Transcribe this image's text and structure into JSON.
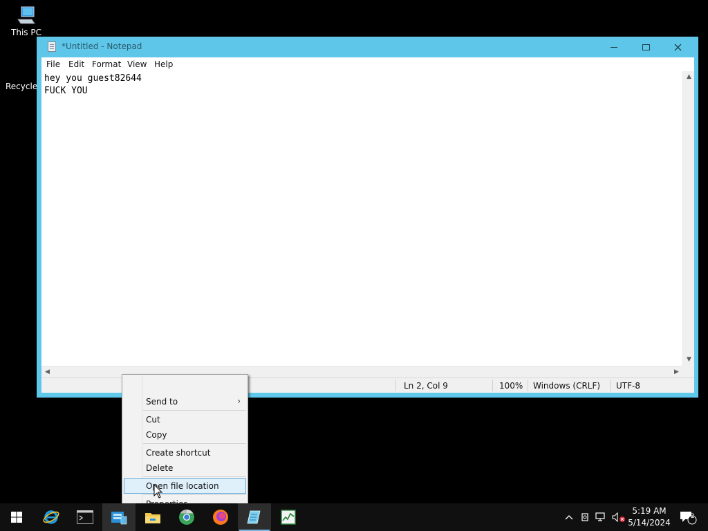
{
  "desktop": {
    "icons": [
      {
        "label": "This PC"
      },
      {
        "label": "Recycle"
      }
    ]
  },
  "notepad": {
    "title": "*Untitled - Notepad",
    "menu": [
      "File",
      "Edit",
      "Format",
      "View",
      "Help"
    ],
    "content_lines": [
      "hey you guest82644",
      "FUCK YOU"
    ],
    "status": {
      "position": "Ln 2, Col 9",
      "zoom": "100%",
      "line_endings": "Windows (CRLF)",
      "encoding": "UTF-8"
    }
  },
  "context_menu": {
    "items": [
      {
        "label": "Send to"
      },
      {
        "label": "Cut"
      },
      {
        "label": "Copy"
      },
      {
        "label": "Create shortcut"
      },
      {
        "label": "Delete"
      },
      {
        "label": "Open file location"
      },
      {
        "label": "Properties"
      }
    ],
    "highlighted": "Open file location"
  },
  "taskbar": {
    "apps": [
      "start-icon",
      "internet-explorer-icon",
      "command-prompt-icon",
      "server-manager-icon",
      "file-explorer-icon",
      "chrome-icon",
      "firefox-icon",
      "notepad-icon",
      "task-manager-icon"
    ],
    "clock": {
      "time": "5:19 AM",
      "date": "5/14/2024"
    },
    "notification_count": "2"
  },
  "colors": {
    "titlebar": "#5ec7e9",
    "highlight": "#dff0fb",
    "highlight_border": "#5fa9dc"
  }
}
